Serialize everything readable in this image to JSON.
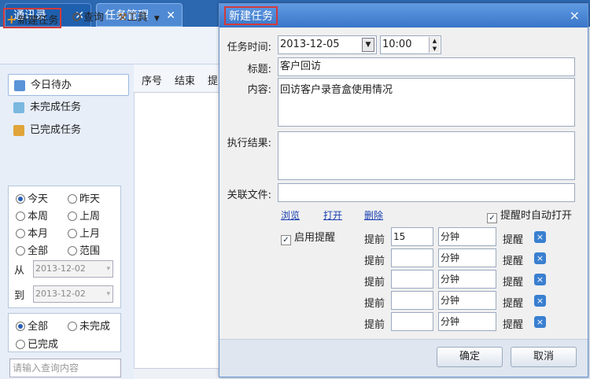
{
  "tabs": [
    {
      "label": "通讯录",
      "close": "✕"
    },
    {
      "label": "任务管理",
      "close": "✕"
    }
  ],
  "toolbar": {
    "new_task": "新建任务",
    "query": "查询",
    "tools": "工具"
  },
  "sidebar": {
    "nav": [
      "今日待办",
      "未完成任务",
      "已完成任务"
    ],
    "range": [
      "今天",
      "昨天",
      "本周",
      "上周",
      "本月",
      "上月",
      "全部",
      "范围"
    ],
    "from_label": "从",
    "to_label": "到",
    "from_date": "2013-12-02",
    "to_date": "2013-12-02",
    "status": [
      "全部",
      "未完成",
      "已完成"
    ],
    "search_placeholder": "请输入查询内容"
  },
  "grid": {
    "columns": [
      "序号",
      "结束",
      "提"
    ]
  },
  "dialog": {
    "title": "新建任务",
    "close": "×",
    "time_label": "任务时间:",
    "date": "2013-12-05",
    "time": "10:00",
    "subject_label": "标题:",
    "subject": "客户回访",
    "content_label": "内容:",
    "content": "回访客户录音盒使用情况",
    "result_label": "执行结果:",
    "result": "",
    "file_label": "关联文件:",
    "file": "",
    "links": {
      "browse": "浏览",
      "open": "打开",
      "delete": "删除"
    },
    "auto_open": "提醒时自动打开",
    "enable_reminder": "启用提醒",
    "reminders": [
      {
        "before": "提前",
        "value": "15",
        "unit": "分钟",
        "remind": "提醒"
      },
      {
        "before": "提前",
        "value": "",
        "unit": "分钟",
        "remind": "提醒"
      },
      {
        "before": "提前",
        "value": "",
        "unit": "分钟",
        "remind": "提醒"
      },
      {
        "before": "提前",
        "value": "",
        "unit": "分钟",
        "remind": "提醒"
      },
      {
        "before": "提前",
        "value": "",
        "unit": "分钟",
        "remind": "提醒"
      }
    ],
    "ok": "确定",
    "cancel": "取消"
  }
}
